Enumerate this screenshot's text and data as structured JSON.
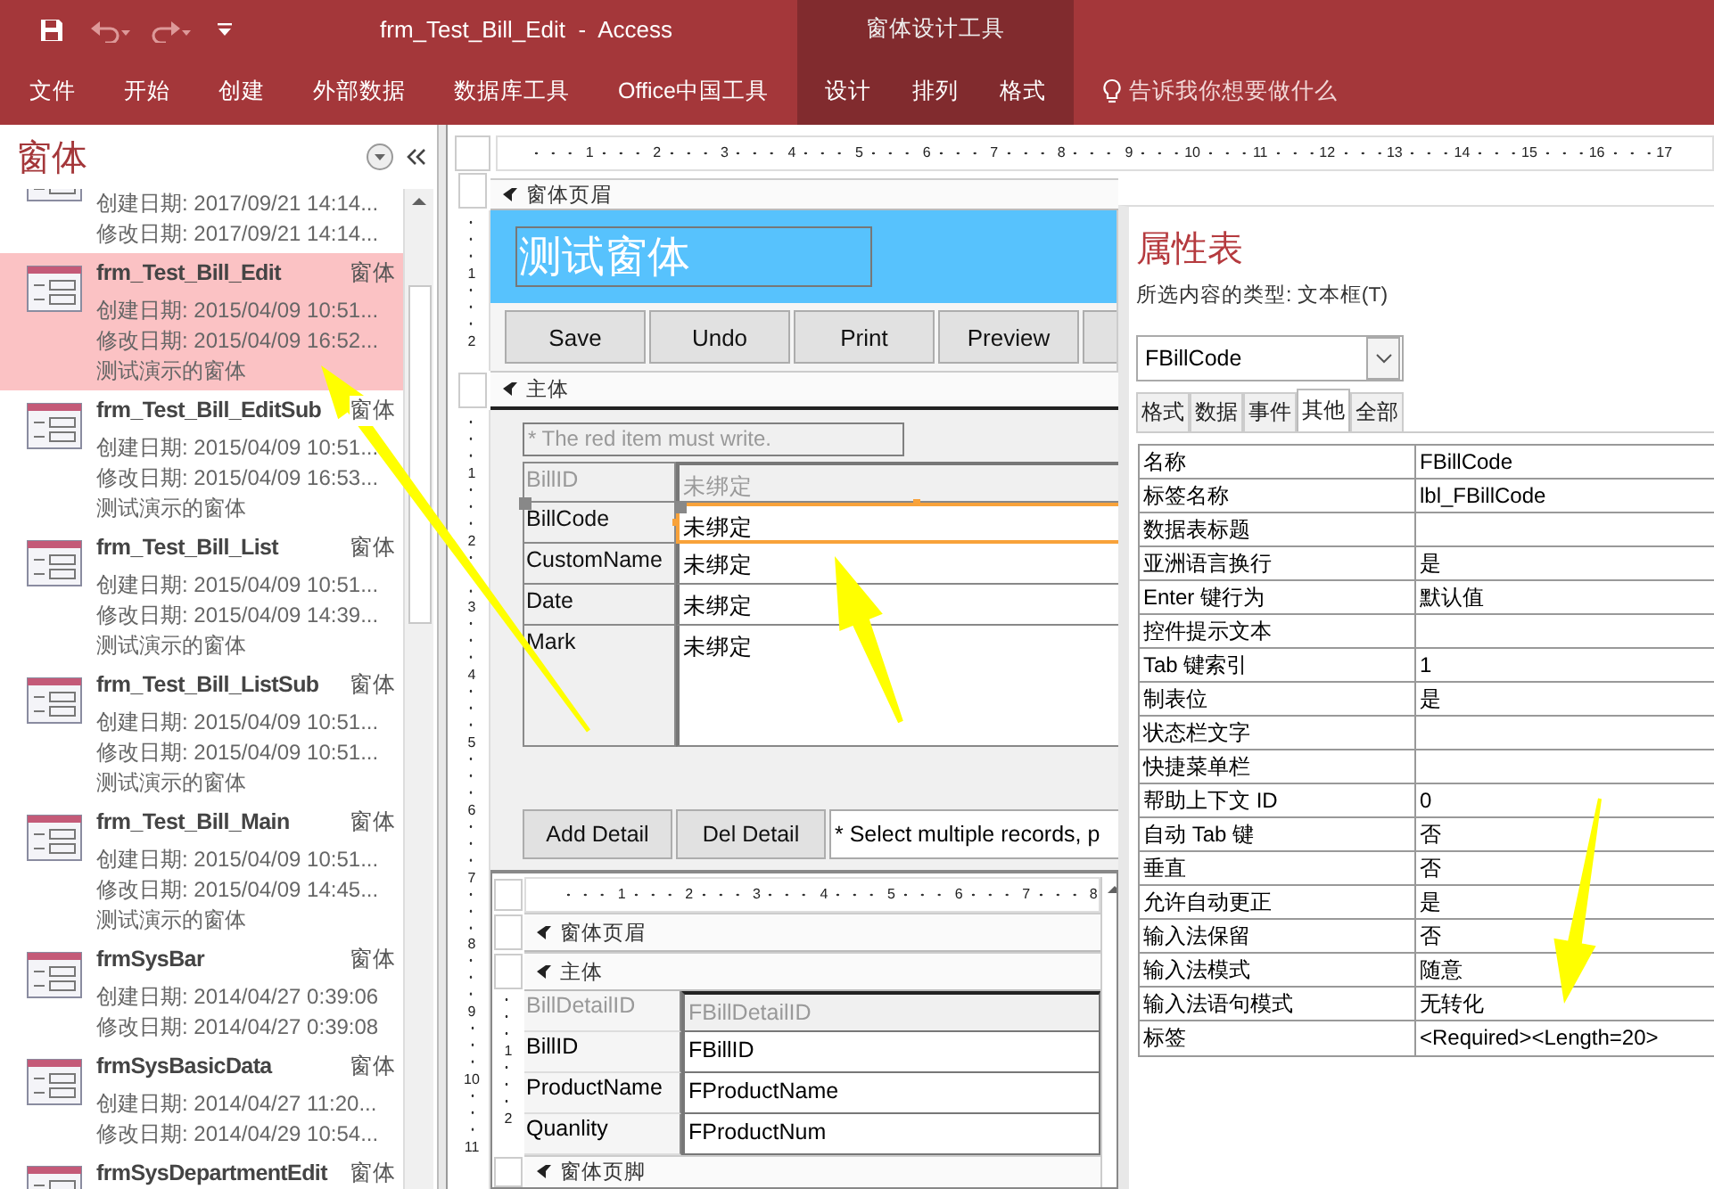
{
  "title_bar": {
    "document_title": "frm_Test_Bill_Edit  -  Access",
    "context_group": "窗体设计工具"
  },
  "ribbon_tabs": [
    {
      "label": "文件",
      "contextual": false
    },
    {
      "label": "开始",
      "contextual": false
    },
    {
      "label": "创建",
      "contextual": false
    },
    {
      "label": "外部数据",
      "contextual": false
    },
    {
      "label": "数据库工具",
      "contextual": false
    },
    {
      "label": "Office中国工具",
      "contextual": false
    },
    {
      "label": "设计",
      "contextual": true
    },
    {
      "label": "排列",
      "contextual": true
    },
    {
      "label": "格式",
      "contextual": true
    }
  ],
  "tell_me": "告诉我你想要做什么",
  "nav_pane": {
    "title": "窗体",
    "items": [
      {
        "created": "创建日期: 2017/09/21 14:14...",
        "modified": "修改日期: 2017/09/21 14:14...",
        "selected": false
      },
      {
        "name": "frm_Test_Bill_Edit",
        "type": "窗体",
        "created": "创建日期: 2015/04/09 10:51...",
        "modified": "修改日期: 2015/04/09 16:52...",
        "description": "测试演示的窗体",
        "selected": true
      },
      {
        "name": "frm_Test_Bill_EditSub",
        "type": "窗体",
        "created": "创建日期: 2015/04/09 10:51...",
        "modified": "修改日期: 2015/04/09 16:53...",
        "description": "测试演示的窗体",
        "selected": false
      },
      {
        "name": "frm_Test_Bill_List",
        "type": "窗体",
        "created": "创建日期: 2015/04/09 10:51...",
        "modified": "修改日期: 2015/04/09 14:39...",
        "description": "测试演示的窗体",
        "selected": false
      },
      {
        "name": "frm_Test_Bill_ListSub",
        "type": "窗体",
        "created": "创建日期: 2015/04/09 10:51...",
        "modified": "修改日期: 2015/04/09 10:51...",
        "description": "测试演示的窗体",
        "selected": false
      },
      {
        "name": "frm_Test_Bill_Main",
        "type": "窗体",
        "created": "创建日期: 2015/04/09 10:51...",
        "modified": "修改日期: 2015/04/09 14:45...",
        "description": "测试演示的窗体",
        "selected": false
      },
      {
        "name": "frmSysBar",
        "type": "窗体",
        "created": "创建日期: 2014/04/27 0:39:06",
        "modified": "修改日期: 2014/04/27 0:39:08",
        "selected": false
      },
      {
        "name": "frmSysBasicData",
        "type": "窗体",
        "created": "创建日期: 2014/04/27 11:20...",
        "modified": "修改日期: 2014/04/29 10:54...",
        "selected": false
      },
      {
        "name": "frmSysDepartmentEdit",
        "type": "窗体",
        "selected": false
      }
    ]
  },
  "design": {
    "top_ruler": [
      "1",
      "2",
      "3",
      "4",
      "5",
      "6",
      "7",
      "8",
      "9",
      "10",
      "11",
      "12",
      "13",
      "14",
      "15",
      "16",
      "17"
    ],
    "header_ruler": [
      "1",
      "2"
    ],
    "detail_ruler": [
      "1",
      "2",
      "3",
      "4",
      "5",
      "6",
      "7",
      "8",
      "9",
      "10",
      "11"
    ],
    "header_section": "窗体页眉",
    "form_title": "测试窗体",
    "header_buttons": [
      "Save",
      "Undo",
      "Print",
      "Preview"
    ],
    "detail_section": "主体",
    "note": "* The red item must write.",
    "fields": [
      {
        "label": "BillID",
        "value": "未绑定",
        "disabled": true,
        "selected": false
      },
      {
        "label": "BillCode",
        "value": "未绑定",
        "disabled": false,
        "selected": true
      },
      {
        "label": "CustomName",
        "value": "未绑定",
        "disabled": false,
        "selected": false
      },
      {
        "label": "Date",
        "value": "未绑定",
        "disabled": false,
        "selected": false
      },
      {
        "label": "Mark",
        "value": "未绑定",
        "disabled": false,
        "selected": false
      }
    ],
    "detail_buttons": [
      "Add Detail",
      "Del Detail"
    ],
    "detail_hint": "* Select multiple records, p",
    "subform": {
      "top_ruler": [
        "1",
        "2",
        "3",
        "4",
        "5",
        "6",
        "7",
        "8"
      ],
      "left_ruler": [
        "1",
        "2"
      ],
      "header_section": "窗体页眉",
      "detail_section": "主体",
      "footer_section": "窗体页脚",
      "fields": [
        {
          "label": "BillDetailID",
          "value": "FBillDetailID",
          "disabled": true
        },
        {
          "label": "BillID",
          "value": "FBillID",
          "disabled": false
        },
        {
          "label": "ProductName",
          "value": "FProductName",
          "disabled": false
        },
        {
          "label": "Quanlity",
          "value": "FProductNum",
          "disabled": false
        }
      ]
    }
  },
  "property_sheet": {
    "title": "属性表",
    "selection_type": "所选内容的类型: 文本框(T)",
    "selected_object": "FBillCode",
    "tabs": [
      {
        "label": "格式",
        "selected": false
      },
      {
        "label": "数据",
        "selected": false
      },
      {
        "label": "事件",
        "selected": false
      },
      {
        "label": "其他",
        "selected": true
      },
      {
        "label": "全部",
        "selected": false
      }
    ],
    "rows": [
      {
        "name": "名称",
        "value": "FBillCode"
      },
      {
        "name": "标签名称",
        "value": "lbl_FBillCode"
      },
      {
        "name": "数据表标题"
      },
      {
        "name": "亚洲语言换行",
        "value": "是"
      },
      {
        "name": "Enter 键行为",
        "value": "默认值"
      },
      {
        "name": "控件提示文本"
      },
      {
        "name": "Tab 键索引",
        "value": "1"
      },
      {
        "name": "制表位",
        "value": "是"
      },
      {
        "name": "状态栏文字"
      },
      {
        "name": "快捷菜单栏"
      },
      {
        "name": "帮助上下文 ID",
        "value": "0"
      },
      {
        "name": "自动 Tab 键",
        "value": "否"
      },
      {
        "name": "垂直",
        "value": "否"
      },
      {
        "name": "允许自动更正",
        "value": "是"
      },
      {
        "name": "输入法保留",
        "value": "否"
      },
      {
        "name": "输入法模式",
        "value": "随意"
      },
      {
        "name": "输入法语句模式",
        "value": "无转化"
      },
      {
        "name": "标签",
        "value": "<Required><Length=20>"
      }
    ]
  }
}
